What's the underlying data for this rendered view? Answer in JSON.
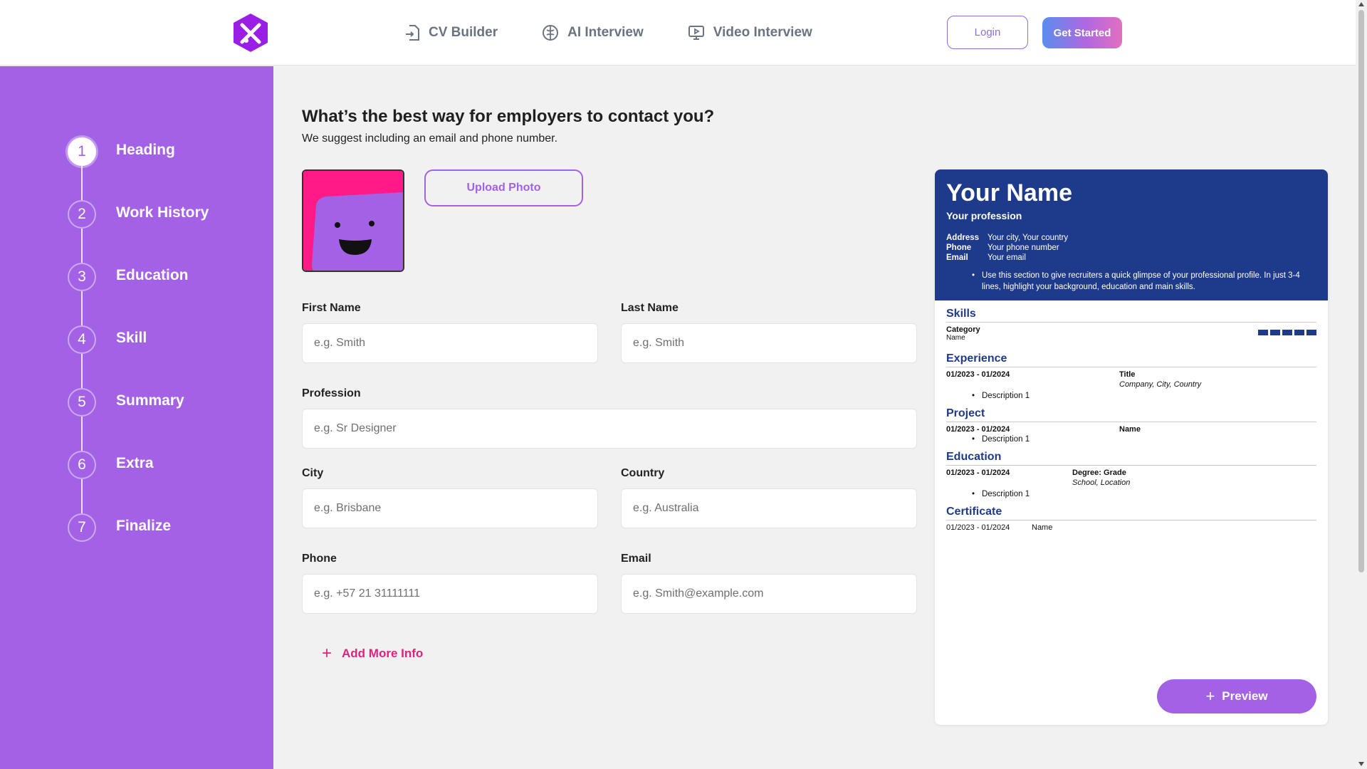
{
  "header": {
    "logo_icon": "hexagon-x-logo-icon",
    "nav": [
      {
        "label": "CV Builder",
        "icon": "file-import-icon"
      },
      {
        "label": "AI Interview",
        "icon": "brain-icon"
      },
      {
        "label": "Video Interview",
        "icon": "monitor-play-icon"
      }
    ],
    "login_label": "Login",
    "get_started_label": "Get Started"
  },
  "sidebar": {
    "steps": [
      {
        "num": "1",
        "label": "Heading",
        "active": true
      },
      {
        "num": "2",
        "label": "Work History"
      },
      {
        "num": "3",
        "label": "Education"
      },
      {
        "num": "4",
        "label": "Skill"
      },
      {
        "num": "5",
        "label": "Summary"
      },
      {
        "num": "6",
        "label": "Extra"
      },
      {
        "num": "7",
        "label": "Finalize"
      }
    ]
  },
  "form": {
    "title": "What’s the best way for employers to contact you?",
    "subtitle": "We suggest including an email and phone number.",
    "upload_label": "Upload Photo",
    "first_name": {
      "label": "First Name",
      "placeholder": "e.g. Smith",
      "value": ""
    },
    "last_name": {
      "label": "Last Name",
      "placeholder": "e.g. Smith",
      "value": ""
    },
    "profession": {
      "label": "Profession",
      "placeholder": "e.g. Sr Designer",
      "value": ""
    },
    "city": {
      "label": "City",
      "placeholder": "e.g. Brisbane",
      "value": ""
    },
    "country": {
      "label": "Country",
      "placeholder": "e.g. Australia",
      "value": ""
    },
    "phone": {
      "label": "Phone",
      "placeholder": "e.g. +57 21 31111111",
      "value": ""
    },
    "email": {
      "label": "Email",
      "placeholder": "e.g. Smith@example.com",
      "value": ""
    },
    "add_more_label": "Add More Info"
  },
  "cv": {
    "name": "Your Name",
    "profession": "Your profession",
    "address_label": "Address",
    "address": "Your city, Your country",
    "phone_label": "Phone",
    "phone": "Your phone number",
    "email_label": "Email",
    "email": "Your email",
    "summary": "Use this section to give recruiters a quick glimpse of your professional profile. In just 3-4 lines, highlight your background, education and main skills.",
    "skills": {
      "heading": "Skills",
      "category": "Category",
      "name": "Name",
      "level": 5
    },
    "experience": {
      "heading": "Experience",
      "dates": "01/2023 - 01/2024",
      "title": "Title",
      "place": "Company, City, Country",
      "desc": "Description 1"
    },
    "project": {
      "heading": "Project",
      "dates": "01/2023 - 01/2024",
      "name": "Name",
      "desc": "Description 1"
    },
    "education": {
      "heading": "Education",
      "dates": "01/2023 - 01/2024",
      "degree": "Degree: Grade",
      "school": "School, Location",
      "desc": "Description 1"
    },
    "certificate": {
      "heading": "Certificate",
      "dates": "01/2023 - 01/2024",
      "name": "Name"
    },
    "preview_label": "Preview"
  },
  "colors": {
    "accent": "#a361e6",
    "cv_header": "#1e3a8a",
    "add_more": "#e2227c"
  }
}
